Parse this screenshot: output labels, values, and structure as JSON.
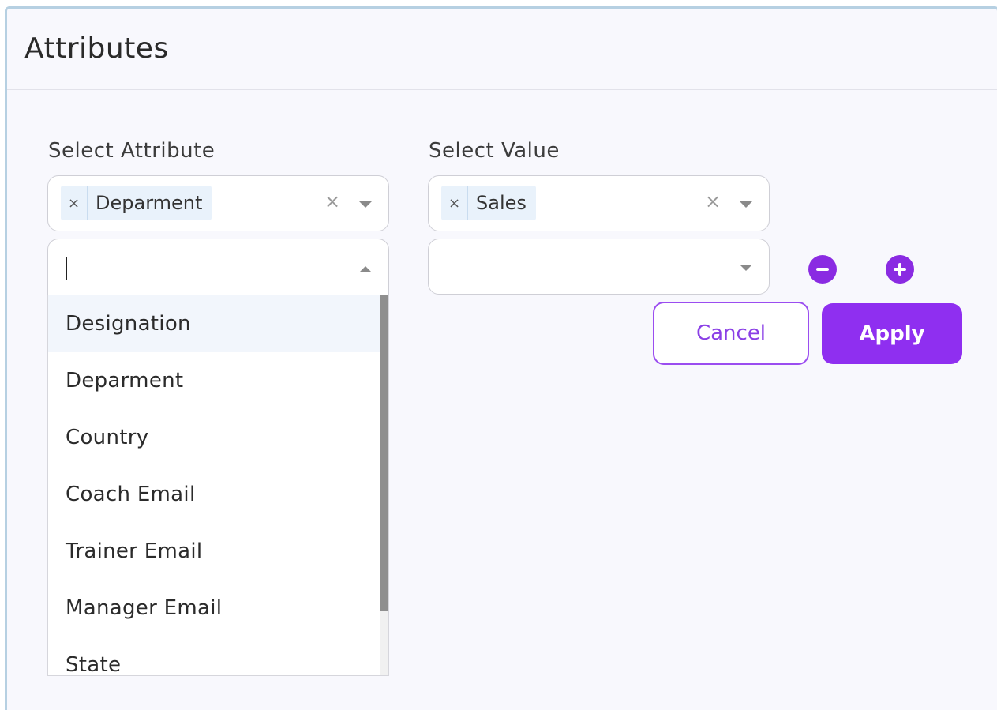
{
  "panel": {
    "title": "Attributes"
  },
  "attribute_field": {
    "label": "Select Attribute",
    "selected_chip": "Deparment",
    "chip_remove_icon": "×",
    "clear_icon": "×"
  },
  "value_field": {
    "label": "Select Value",
    "selected_chip": "Sales",
    "chip_remove_icon": "×",
    "clear_icon": "×"
  },
  "attribute_search": {
    "value": ""
  },
  "attribute_dropdown": {
    "options": [
      "Designation",
      "Deparment",
      "Country",
      "Coach Email",
      "Trainer Email",
      "Manager Email",
      "State"
    ],
    "highlighted_index": 0
  },
  "actions": {
    "remove_row_icon": "minus-circle-icon",
    "add_row_icon": "plus-circle-icon",
    "cancel_label": "Cancel",
    "apply_label": "Apply"
  },
  "colors": {
    "accent": "#8f2ff0",
    "panel_border": "#b6d0e2",
    "chip_bg": "#e9f2fb"
  }
}
